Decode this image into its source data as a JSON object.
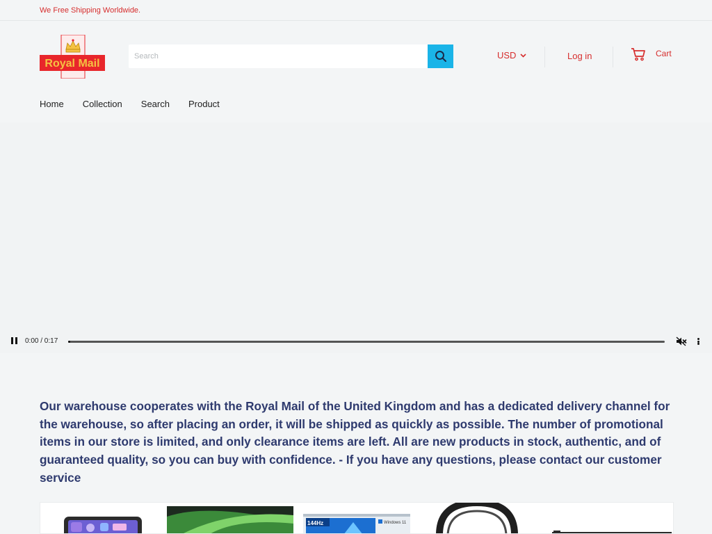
{
  "announcement": "We Free Shipping Worldwide.",
  "brand": {
    "logo_text": "Royal Mail",
    "colors": {
      "red": "#e8262b",
      "gold": "#f5c242",
      "accent": "#1ab4e8",
      "link": "#d62d2d"
    }
  },
  "search": {
    "placeholder": "Search",
    "button_icon": "search-icon"
  },
  "header": {
    "currency": "USD",
    "login_label": "Log in",
    "cart_label": "Cart"
  },
  "nav": {
    "items": [
      "Home",
      "Collection",
      "Search",
      "Product"
    ]
  },
  "video": {
    "time": "0:00 / 0:17",
    "progress_fraction": 0,
    "muted": true
  },
  "intro_text": "Our warehouse cooperates with the Royal Mail of the United Kingdom and has a dedicated delivery channel for the warehouse, so after placing an order, it will be shipped as quickly as possible. The number of promotional items in our store is limited, and only clearance items are left. All are new products in stock, authentic, and of guaranteed quality, so you can buy with confidence. - If you have any questions, please contact our customer service",
  "products": {
    "items": [
      {
        "name": "tablet",
        "icon": "tablet-image"
      },
      {
        "name": "laptop",
        "icon": "laptop-image"
      },
      {
        "name": "monitor-box",
        "icon": "monitor-box-image",
        "labels": [
          "144Hz",
          "Windows 11"
        ]
      },
      {
        "name": "headphones",
        "icon": "headphones-image"
      },
      {
        "name": "display",
        "icon": "display-image"
      }
    ]
  }
}
